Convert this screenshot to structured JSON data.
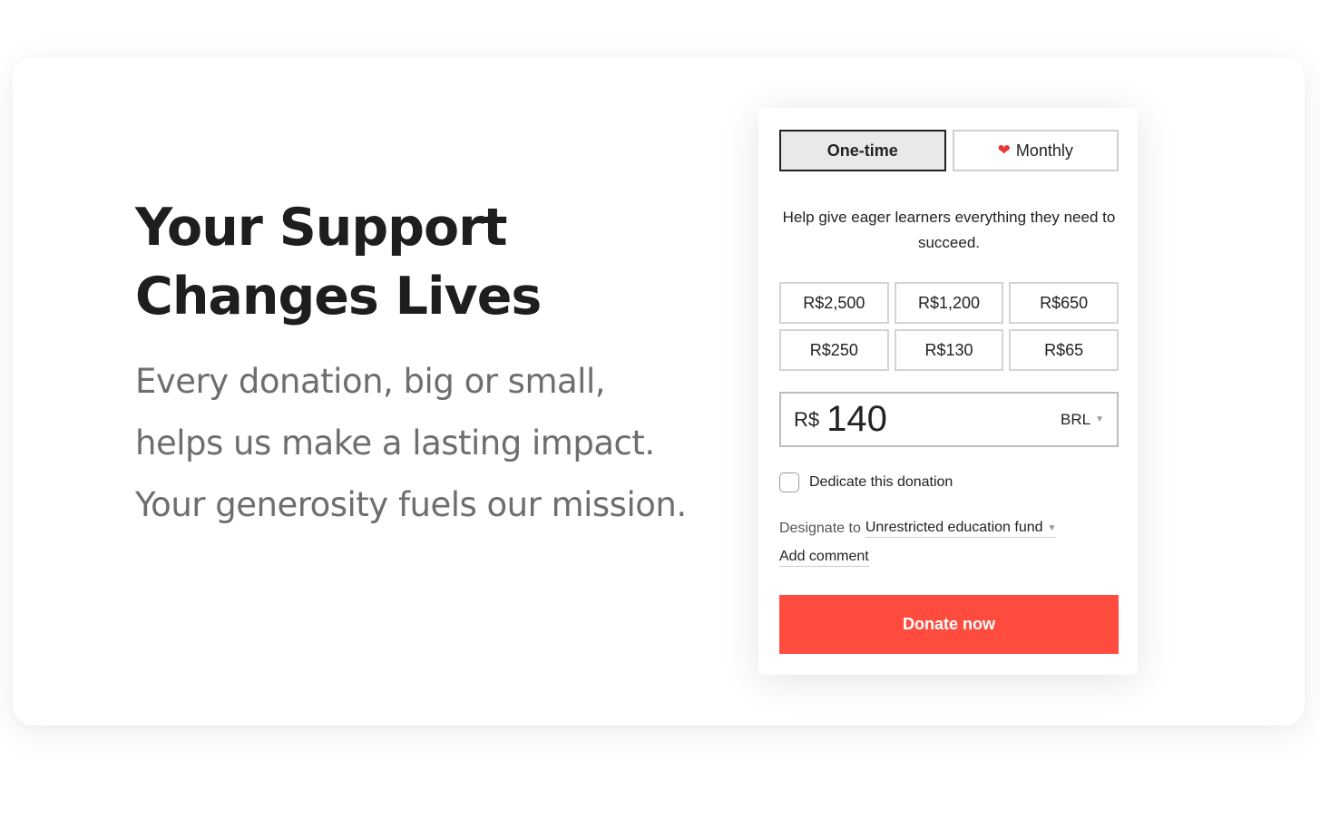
{
  "hero": {
    "headline": "Your Support\nChanges Lives",
    "subtext": "Every donation, big or small, helps us make a lasting impact. Your generosity fuels our mission."
  },
  "form": {
    "frequency": {
      "one_time_label": "One-time",
      "monthly_label": "Monthly",
      "selected": "One-time"
    },
    "blurb": "Help give eager learners everything they need to succeed.",
    "amounts": [
      "R$2,500",
      "R$1,200",
      "R$650",
      "R$250",
      "R$130",
      "R$65"
    ],
    "amount_input": {
      "currency_symbol": "R$",
      "value": "140",
      "currency_code": "BRL"
    },
    "dedicate_label": "Dedicate this donation",
    "dedicate_checked": false,
    "designate_prefix": "Designate to",
    "designate_value": "Unrestricted education fund",
    "comment_label": "Add comment",
    "donate_label": "Donate now"
  },
  "colors": {
    "donate_button": "#ff4c3f",
    "heart": "#e53935",
    "headline": "#1e1e1e",
    "subtext": "#6e6e6e"
  },
  "icons": {
    "heart": "heart-icon",
    "caret": "caret-down-icon"
  }
}
